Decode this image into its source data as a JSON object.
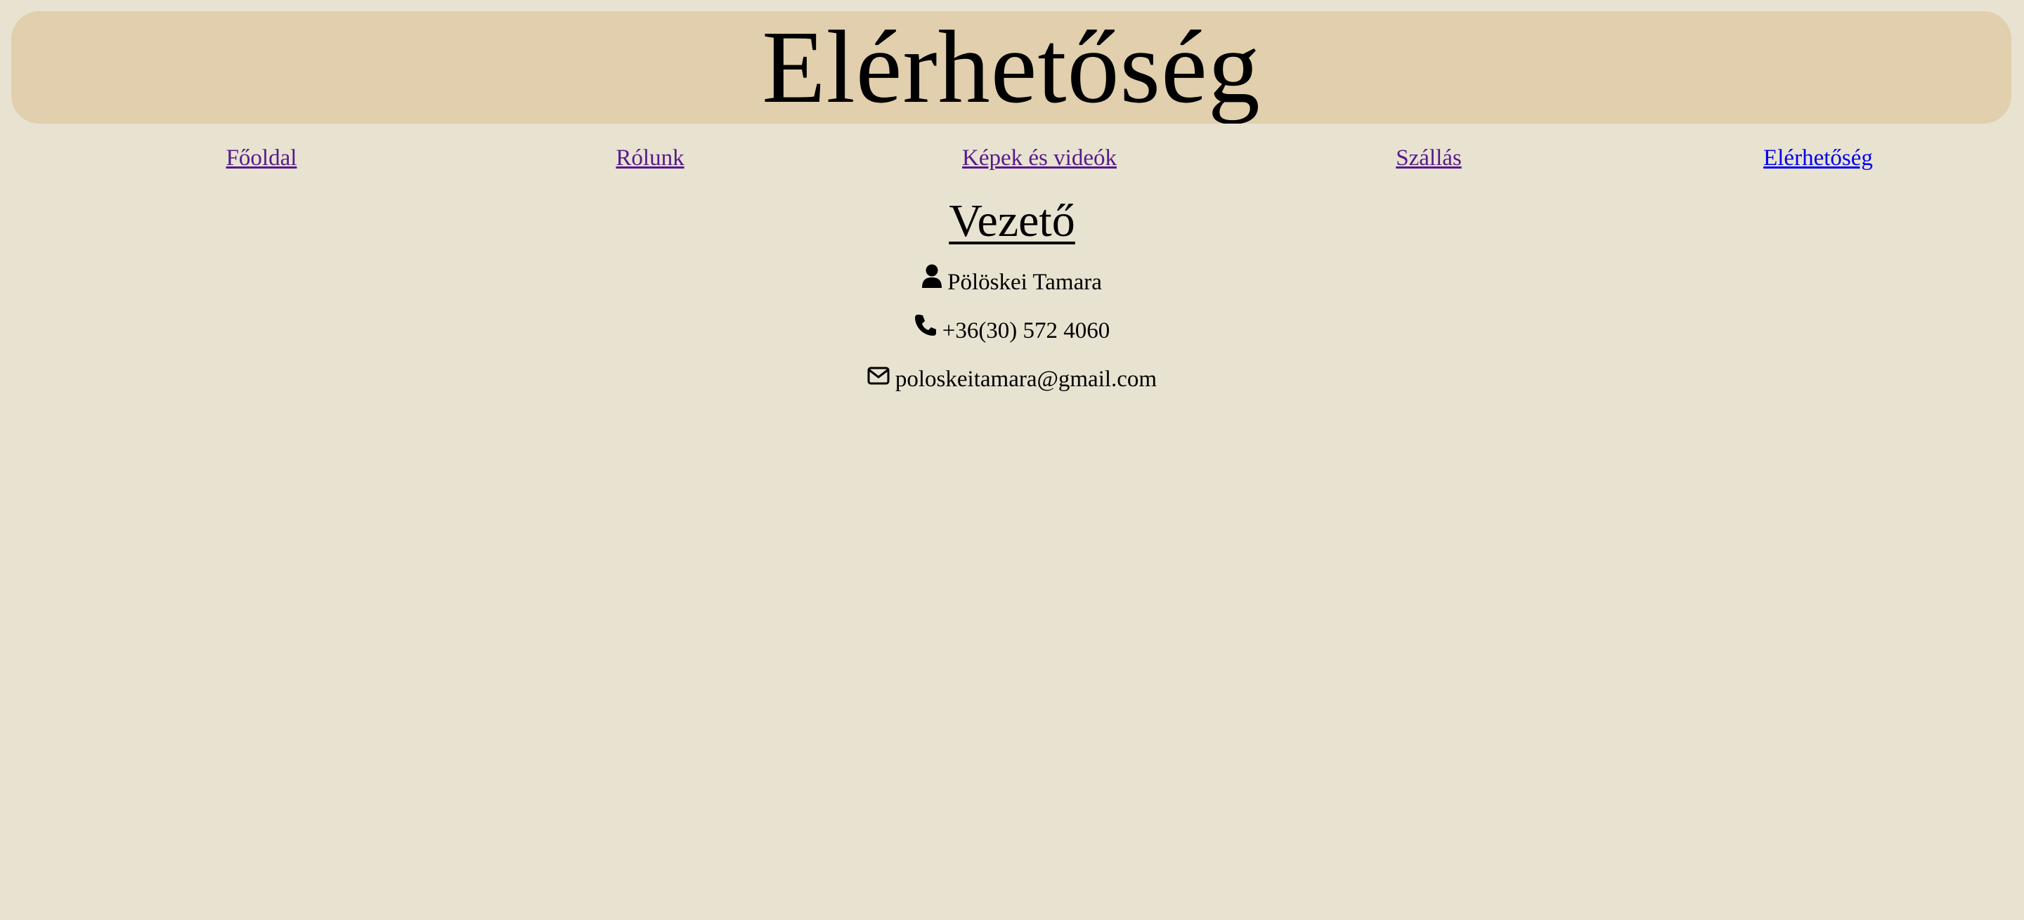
{
  "header": {
    "title": "Elérhetőség"
  },
  "nav": {
    "items": [
      {
        "label": "Főoldal",
        "state": "visited"
      },
      {
        "label": "Rólunk",
        "state": "visited"
      },
      {
        "label": "Képek és videók",
        "state": "visited"
      },
      {
        "label": "Szállás",
        "state": "visited"
      },
      {
        "label": "Elérhetőség",
        "state": "current"
      }
    ],
    "colors": {
      "visited": "#551a8b",
      "current": "#0000ee"
    }
  },
  "main": {
    "section_title": "Vezető",
    "contacts": {
      "name": {
        "icon": "user-icon",
        "text": "Pölöskei Tamara"
      },
      "phone": {
        "icon": "phone-icon",
        "text": "+36(30) 572 4060"
      },
      "email": {
        "icon": "envelope-icon",
        "text": "poloskeitamara@gmail.com"
      }
    }
  },
  "colors": {
    "page_background": "#e8e2d1",
    "header_background": "#e1cfad",
    "text": "#000000"
  }
}
